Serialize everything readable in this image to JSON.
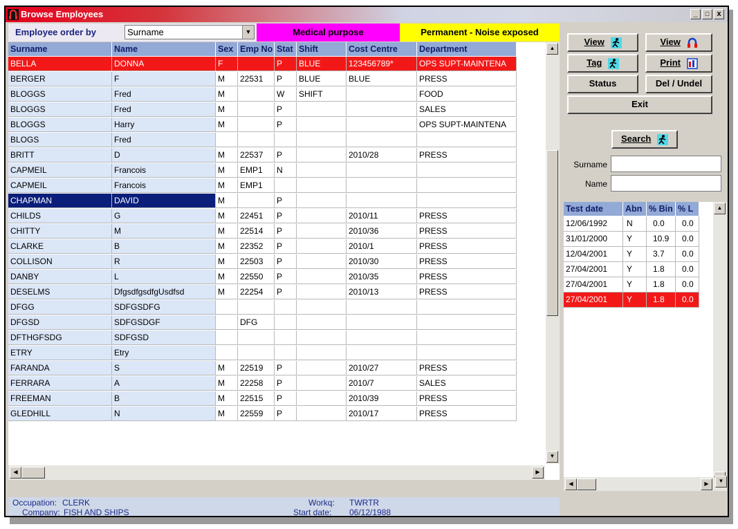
{
  "window": {
    "title": "Browse Employees",
    "min": "_",
    "max": "□",
    "close": "x"
  },
  "order": {
    "label": "Employee order by",
    "value": "Surname"
  },
  "tags": {
    "medical": "Medical purpose",
    "noise": "Permanent - Noise exposed",
    "medical_color": "#ff00ff",
    "noise_color": "#ffff00"
  },
  "grid": {
    "columns": [
      "Surname",
      "Name",
      "Sex",
      "Emp No",
      "Stat",
      "Shift",
      "Cost Centre",
      "Department"
    ],
    "rows": [
      [
        "BELLA",
        "DONNA",
        "F",
        "",
        "P",
        "BLUE",
        "123456789*",
        "OPS SUPT-MAINTENA"
      ],
      [
        "BERGER",
        "F",
        "M",
        "22531",
        "P",
        "BLUE",
        "BLUE",
        "PRESS"
      ],
      [
        "BLOGGS",
        "Fred",
        "M",
        "",
        "W",
        "SHIFT",
        "",
        "FOOD"
      ],
      [
        "BLOGGS",
        "Fred",
        "M",
        "",
        "P",
        "",
        "",
        "SALES"
      ],
      [
        "BLOGGS",
        "Harry",
        "M",
        "",
        "P",
        "",
        "",
        "OPS SUPT-MAINTENA"
      ],
      [
        "BLOGS",
        "Fred",
        "",
        "",
        "",
        "",
        "",
        ""
      ],
      [
        "BRITT",
        "D",
        "M",
        "22537",
        "P",
        "",
        "2010/28",
        "PRESS"
      ],
      [
        "CAPMEIL",
        "Francois",
        "M",
        "EMP1",
        "N",
        "",
        "",
        ""
      ],
      [
        "CAPMEIL",
        "Francois",
        "M",
        "EMP1",
        "",
        "",
        "",
        ""
      ],
      [
        "CHAPMAN",
        "DAVID",
        "M",
        "",
        "P",
        "",
        "",
        ""
      ],
      [
        "CHILDS",
        "G",
        "M",
        "22451",
        "P",
        "",
        "2010/11",
        "PRESS"
      ],
      [
        "CHITTY",
        "M",
        "M",
        "22514",
        "P",
        "",
        "2010/36",
        "PRESS"
      ],
      [
        "CLARKE",
        "B",
        "M",
        "22352",
        "P",
        "",
        "2010/1",
        "PRESS"
      ],
      [
        "COLLISON",
        "R",
        "M",
        "22503",
        "P",
        "",
        "2010/30",
        "PRESS"
      ],
      [
        "DANBY",
        "L",
        "M",
        "22550",
        "P",
        "",
        "2010/35",
        "PRESS"
      ],
      [
        "DESELMS",
        "DfgsdfgsdfgUsdfsd",
        "M",
        "22254",
        "P",
        "",
        "2010/13",
        "PRESS"
      ],
      [
        "DFGG",
        "SDFGSDFG",
        "",
        "",
        "",
        "",
        "",
        ""
      ],
      [
        "DFGSD",
        "SDFGSDGF",
        "",
        "DFG",
        "",
        "",
        "",
        ""
      ],
      [
        "DFTHGFSDG",
        "SDFGSD",
        "",
        "",
        "",
        "",
        "",
        ""
      ],
      [
        "ETRY",
        "Etry",
        "",
        "",
        "",
        "",
        "",
        ""
      ],
      [
        "FARANDA",
        "S",
        "M",
        "22519",
        "P",
        "",
        "2010/27",
        "PRESS"
      ],
      [
        "FERRARA",
        "A",
        "M",
        "22258",
        "P",
        "",
        "2010/7",
        "SALES"
      ],
      [
        "FREEMAN",
        "B",
        "M",
        "22515",
        "P",
        "",
        "2010/39",
        "PRESS"
      ],
      [
        "GLEDHILL",
        "N",
        "M",
        "22559",
        "P",
        "",
        "2010/17",
        "PRESS"
      ]
    ],
    "selected_row_color": "#f31818",
    "highlight_color": "#0a1e7a"
  },
  "status": {
    "occupation_label": "Occupation:",
    "occupation": "CLERK",
    "company_label": "Company:",
    "company": "FISH AND SHIPS",
    "workq_label": "Workq:",
    "workq": "TWRTR",
    "start_label": "Start date:",
    "start": "06/12/1988"
  },
  "buttons": {
    "view1": "View",
    "view2": "View",
    "tag": "Tag",
    "print": "Print",
    "status": "Status",
    "delundel": "Del / Undel",
    "exit": "Exit",
    "search": "Search"
  },
  "search": {
    "surname_label": "Surname",
    "name_label": "Name",
    "surname_value": "",
    "name_value": ""
  },
  "tests": {
    "columns": [
      "Test date",
      "Abn",
      "% Bin",
      "% L"
    ],
    "rows": [
      [
        "12/06/1992",
        "N",
        "0.0",
        "0.0"
      ],
      [
        "31/01/2000",
        "Y",
        "10.9",
        "0.0"
      ],
      [
        "12/04/2001",
        "Y",
        "3.7",
        "0.0"
      ],
      [
        "27/04/2001",
        "Y",
        "1.8",
        "0.0"
      ],
      [
        "27/04/2001",
        "Y",
        "1.8",
        "0.0"
      ],
      [
        "27/04/2001",
        "Y",
        "1.8",
        "0.0"
      ]
    ]
  },
  "icons": [
    "app-icon",
    "walking-man-icon",
    "headphones-icon",
    "print-chart-icon"
  ]
}
